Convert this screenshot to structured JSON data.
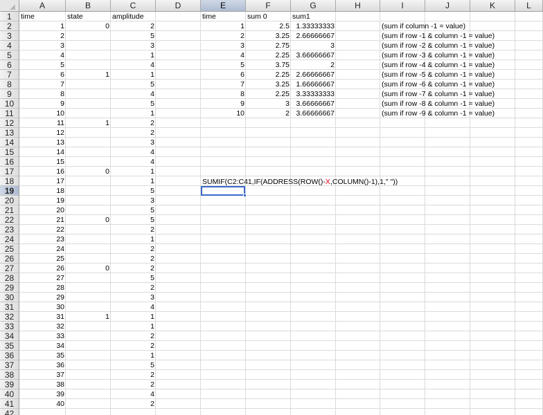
{
  "columns": [
    "A",
    "B",
    "C",
    "D",
    "E",
    "F",
    "G",
    "H",
    "I",
    "J",
    "K",
    "L"
  ],
  "selected_column": "E",
  "selected_row": 19,
  "row_numbers": [
    1,
    2,
    3,
    4,
    5,
    6,
    7,
    8,
    9,
    10,
    11,
    12,
    13,
    14,
    15,
    16,
    17,
    18,
    19,
    20,
    21,
    22,
    23,
    24,
    25,
    26,
    27,
    28,
    29,
    30,
    31,
    32,
    33,
    34,
    35,
    36,
    37,
    38,
    39,
    40,
    41,
    42
  ],
  "headers": {
    "A1": "time",
    "B1": "state",
    "C1": "amplitude",
    "E1": "time",
    "F1": "sum 0",
    "G1": "sum1"
  },
  "data_rows": [
    {
      "time": "1",
      "state": "0",
      "amplitude": "2"
    },
    {
      "time": "2",
      "state": "",
      "amplitude": "5"
    },
    {
      "time": "3",
      "state": "",
      "amplitude": "3"
    },
    {
      "time": "4",
      "state": "",
      "amplitude": "1"
    },
    {
      "time": "5",
      "state": "",
      "amplitude": "4"
    },
    {
      "time": "6",
      "state": "1",
      "amplitude": "1"
    },
    {
      "time": "7",
      "state": "",
      "amplitude": "5"
    },
    {
      "time": "8",
      "state": "",
      "amplitude": "4"
    },
    {
      "time": "9",
      "state": "",
      "amplitude": "5"
    },
    {
      "time": "10",
      "state": "",
      "amplitude": "1"
    },
    {
      "time": "11",
      "state": "1",
      "amplitude": "2"
    },
    {
      "time": "12",
      "state": "",
      "amplitude": "2"
    },
    {
      "time": "13",
      "state": "",
      "amplitude": "3"
    },
    {
      "time": "14",
      "state": "",
      "amplitude": "4"
    },
    {
      "time": "15",
      "state": "",
      "amplitude": "4"
    },
    {
      "time": "16",
      "state": "0",
      "amplitude": "1"
    },
    {
      "time": "17",
      "state": "",
      "amplitude": "1"
    },
    {
      "time": "18",
      "state": "",
      "amplitude": "5"
    },
    {
      "time": "19",
      "state": "",
      "amplitude": "3"
    },
    {
      "time": "20",
      "state": "",
      "amplitude": "5"
    },
    {
      "time": "21",
      "state": "0",
      "amplitude": "5"
    },
    {
      "time": "22",
      "state": "",
      "amplitude": "2"
    },
    {
      "time": "23",
      "state": "",
      "amplitude": "1"
    },
    {
      "time": "24",
      "state": "",
      "amplitude": "2"
    },
    {
      "time": "25",
      "state": "",
      "amplitude": "2"
    },
    {
      "time": "26",
      "state": "0",
      "amplitude": "2"
    },
    {
      "time": "27",
      "state": "",
      "amplitude": "5"
    },
    {
      "time": "28",
      "state": "",
      "amplitude": "2"
    },
    {
      "time": "29",
      "state": "",
      "amplitude": "3"
    },
    {
      "time": "30",
      "state": "",
      "amplitude": "4"
    },
    {
      "time": "31",
      "state": "1",
      "amplitude": "1"
    },
    {
      "time": "32",
      "state": "",
      "amplitude": "1"
    },
    {
      "time": "33",
      "state": "",
      "amplitude": "2"
    },
    {
      "time": "34",
      "state": "",
      "amplitude": "2"
    },
    {
      "time": "35",
      "state": "",
      "amplitude": "1"
    },
    {
      "time": "36",
      "state": "",
      "amplitude": "5"
    },
    {
      "time": "37",
      "state": "",
      "amplitude": "2"
    },
    {
      "time": "38",
      "state": "",
      "amplitude": "2"
    },
    {
      "time": "39",
      "state": "",
      "amplitude": "4"
    },
    {
      "time": "40",
      "state": "",
      "amplitude": "2"
    }
  ],
  "summary_rows": [
    {
      "time": "1",
      "sum0": "2.5",
      "sum1": "1.33333333",
      "note": "(sum if column -1 = value)"
    },
    {
      "time": "2",
      "sum0": "3.25",
      "sum1": "2.66666667",
      "note": "(sum if row -1 & column -1 = value)"
    },
    {
      "time": "3",
      "sum0": "2.75",
      "sum1": "3",
      "note": "(sum if row -2 & column -1 = value)"
    },
    {
      "time": "4",
      "sum0": "2.25",
      "sum1": "3.66666667",
      "note": "(sum if row -3 & column -1 = value)"
    },
    {
      "time": "5",
      "sum0": "3.75",
      "sum1": "2",
      "note": "(sum if row -4 & column -1 = value)"
    },
    {
      "time": "6",
      "sum0": "2.25",
      "sum1": "2.66666667",
      "note": "(sum if row -5 & column -1 = value)"
    },
    {
      "time": "7",
      "sum0": "3.25",
      "sum1": "1.66666667",
      "note": "(sum if row -6 & column -1 = value)"
    },
    {
      "time": "8",
      "sum0": "2.25",
      "sum1": "3.33333333",
      "note": "(sum if row -7 & column -1 = value)"
    },
    {
      "time": "9",
      "sum0": "3",
      "sum1": "3.66666667",
      "note": "(sum if row -8 & column -1 = value)"
    },
    {
      "time": "10",
      "sum0": "2",
      "sum1": "3.66666667",
      "note": "(sum if row -9 & column -1 = value)"
    }
  ],
  "formula": {
    "part1": "SUMIF(C2:C41,IF(ADDRESS(ROW()-",
    "x": "X",
    "part2": ",COLUMN()-1),1,\" \"))"
  },
  "colors": {
    "selection": "#3a68c8",
    "formula_x": "#e0001b"
  }
}
